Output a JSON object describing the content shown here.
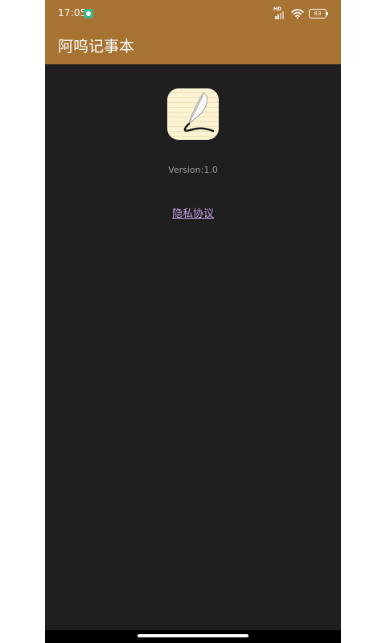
{
  "status_bar": {
    "time": "17:05",
    "battery": "83",
    "network_label": "HD",
    "notification_icon": "app-notification-icon",
    "signal_icon": "signal-icon",
    "wifi_icon": "wifi-icon",
    "battery_icon": "battery-icon"
  },
  "app_bar": {
    "title": "阿呜记事本",
    "color": "#a67332"
  },
  "about": {
    "app_icon": "quill-pen-notepad-icon",
    "version": "Version:1.0",
    "privacy_link": "隐私协议"
  },
  "theme": {
    "background": "#1f1f1f",
    "link_color": "#c69ee8"
  }
}
